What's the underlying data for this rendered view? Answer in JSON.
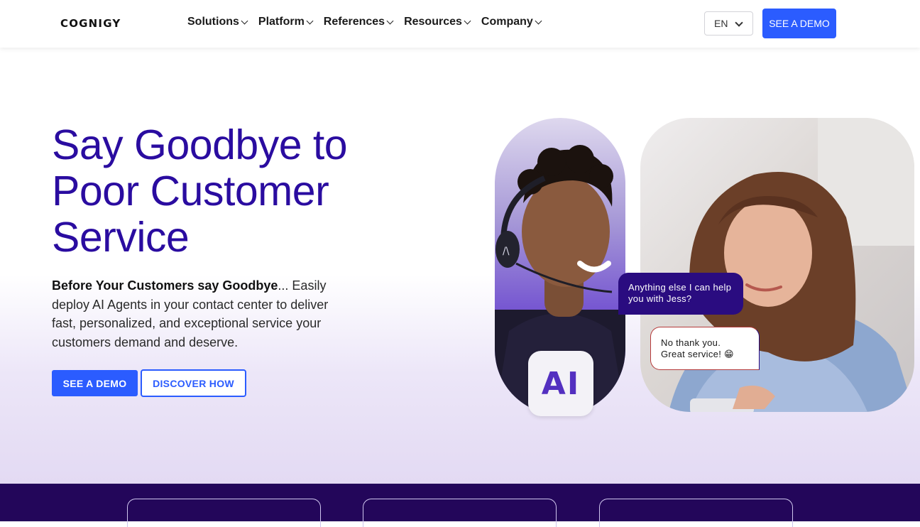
{
  "nav": {
    "logo": "COGNIGY",
    "menu": [
      {
        "label": "Solutions"
      },
      {
        "label": "Platform"
      },
      {
        "label": "References"
      },
      {
        "label": "Resources"
      },
      {
        "label": "Company"
      }
    ],
    "language": "EN",
    "demo_label": "SEE A DEMO"
  },
  "hero": {
    "headline_lines": [
      "Say Goodbye to",
      "Poor Customer",
      "Service"
    ],
    "description_bold": "Before Your Customers say Goodbye",
    "description_rest": "... Easily deploy AI Agents in your contact center to deliver fast, personalized, and exceptional service your customers demand and deserve.",
    "primary_button": "SEE A DEMO",
    "secondary_button": "DISCOVER HOW"
  },
  "visual": {
    "ai_badge": "AI",
    "agent_message": "Anything else I can help you with Jess?",
    "customer_message_line1": "No thank you.",
    "customer_message_line2": "Great service! 😁"
  },
  "colors": {
    "accent": "#2b5cff",
    "headline": "#2a0ca0",
    "strip": "#23065a"
  }
}
